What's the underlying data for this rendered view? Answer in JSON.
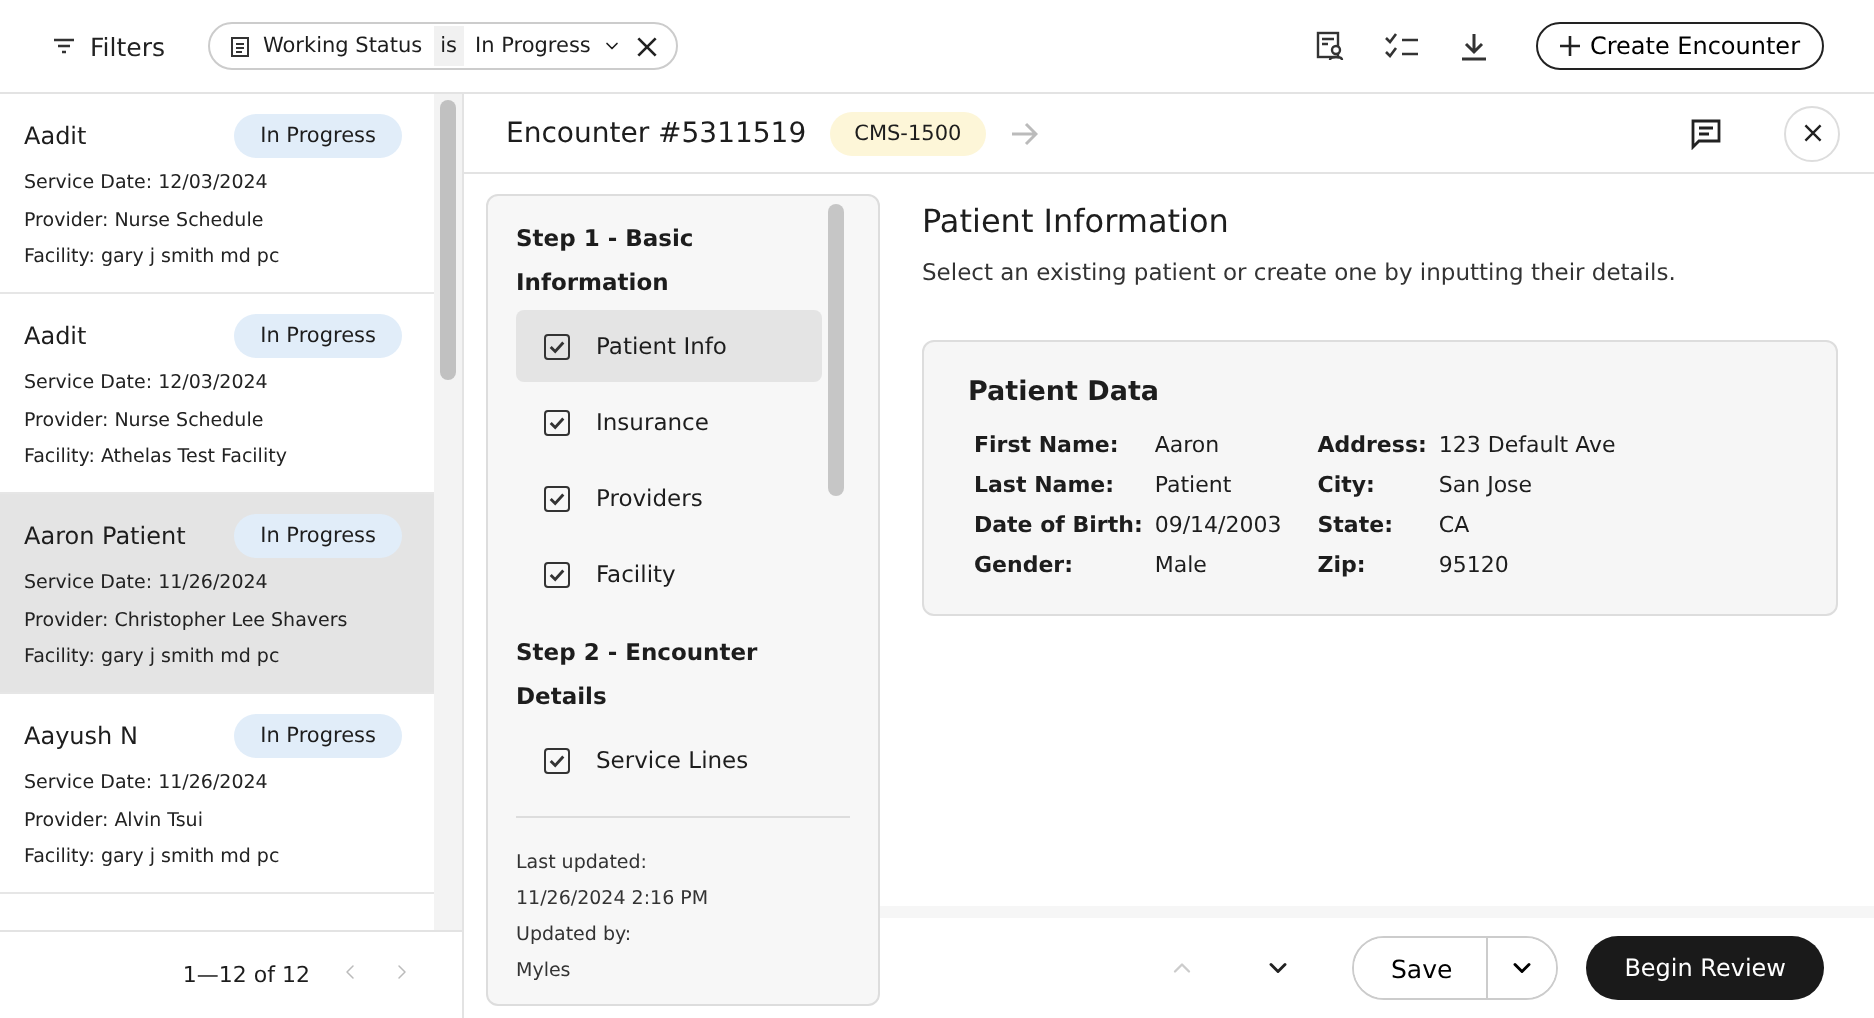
{
  "toolbar": {
    "filters_label": "Filters",
    "filter_chip": {
      "field": "Working Status",
      "operator": "is",
      "value": "In Progress"
    },
    "create_button": "Create Encounter"
  },
  "encounters": [
    {
      "name": "Aadit",
      "status": "In Progress",
      "service_date_label": "Service Date:",
      "service_date": "12/03/2024",
      "provider_label": "Provider:",
      "provider": "Nurse Schedule",
      "facility_label": "Facility:",
      "facility": "gary j smith md pc",
      "selected": false
    },
    {
      "name": "Aadit",
      "status": "In Progress",
      "service_date_label": "Service Date:",
      "service_date": "12/03/2024",
      "provider_label": "Provider:",
      "provider": "Nurse Schedule",
      "facility_label": "Facility:",
      "facility": "Athelas Test Facility",
      "selected": false
    },
    {
      "name": "Aaron Patient",
      "status": "In Progress",
      "service_date_label": "Service Date:",
      "service_date": "11/26/2024",
      "provider_label": "Provider:",
      "provider": "Christopher Lee Shavers",
      "facility_label": "Facility:",
      "facility": "gary j smith md pc",
      "selected": true
    },
    {
      "name": "Aayush N",
      "status": "In Progress",
      "service_date_label": "Service Date:",
      "service_date": "11/26/2024",
      "provider_label": "Provider:",
      "provider": "Alvin Tsui",
      "facility_label": "Facility:",
      "facility": "gary j smith md pc",
      "selected": false
    }
  ],
  "pagination": "1—12 of 12",
  "encounter": {
    "title": "Encounter #5311519",
    "form_badge": "CMS-1500"
  },
  "steps": [
    {
      "title": "Step 1 - Basic Information",
      "items": [
        {
          "label": "Patient Info",
          "checked": true,
          "selected": true
        },
        {
          "label": "Insurance",
          "checked": true,
          "selected": false
        },
        {
          "label": "Providers",
          "checked": true,
          "selected": false
        },
        {
          "label": "Facility",
          "checked": true,
          "selected": false
        }
      ]
    },
    {
      "title": "Step 2 - Encounter Details",
      "items": [
        {
          "label": "Service Lines",
          "checked": true,
          "selected": false
        }
      ]
    }
  ],
  "last_updated_label": "Last updated:",
  "last_updated": "11/26/2024 2:16 PM",
  "updated_by_label": "Updated by:",
  "updated_by": "Myles",
  "section": {
    "title": "Patient Information",
    "subtitle": "Select an existing patient or create one by inputting their details."
  },
  "patient_data": {
    "title": "Patient Data",
    "left": [
      {
        "label": "First Name:",
        "value": "Aaron"
      },
      {
        "label": "Last Name:",
        "value": "Patient"
      },
      {
        "label": "Date of Birth:",
        "value": "09/14/2003"
      },
      {
        "label": "Gender:",
        "value": "Male"
      }
    ],
    "right": [
      {
        "label": "Address:",
        "value": "123 Default Ave"
      },
      {
        "label": "City:",
        "value": "San Jose"
      },
      {
        "label": "State:",
        "value": "CA"
      },
      {
        "label": "Zip:",
        "value": "95120"
      }
    ]
  },
  "footer": {
    "save_button": "Save",
    "review_button": "Begin Review"
  }
}
